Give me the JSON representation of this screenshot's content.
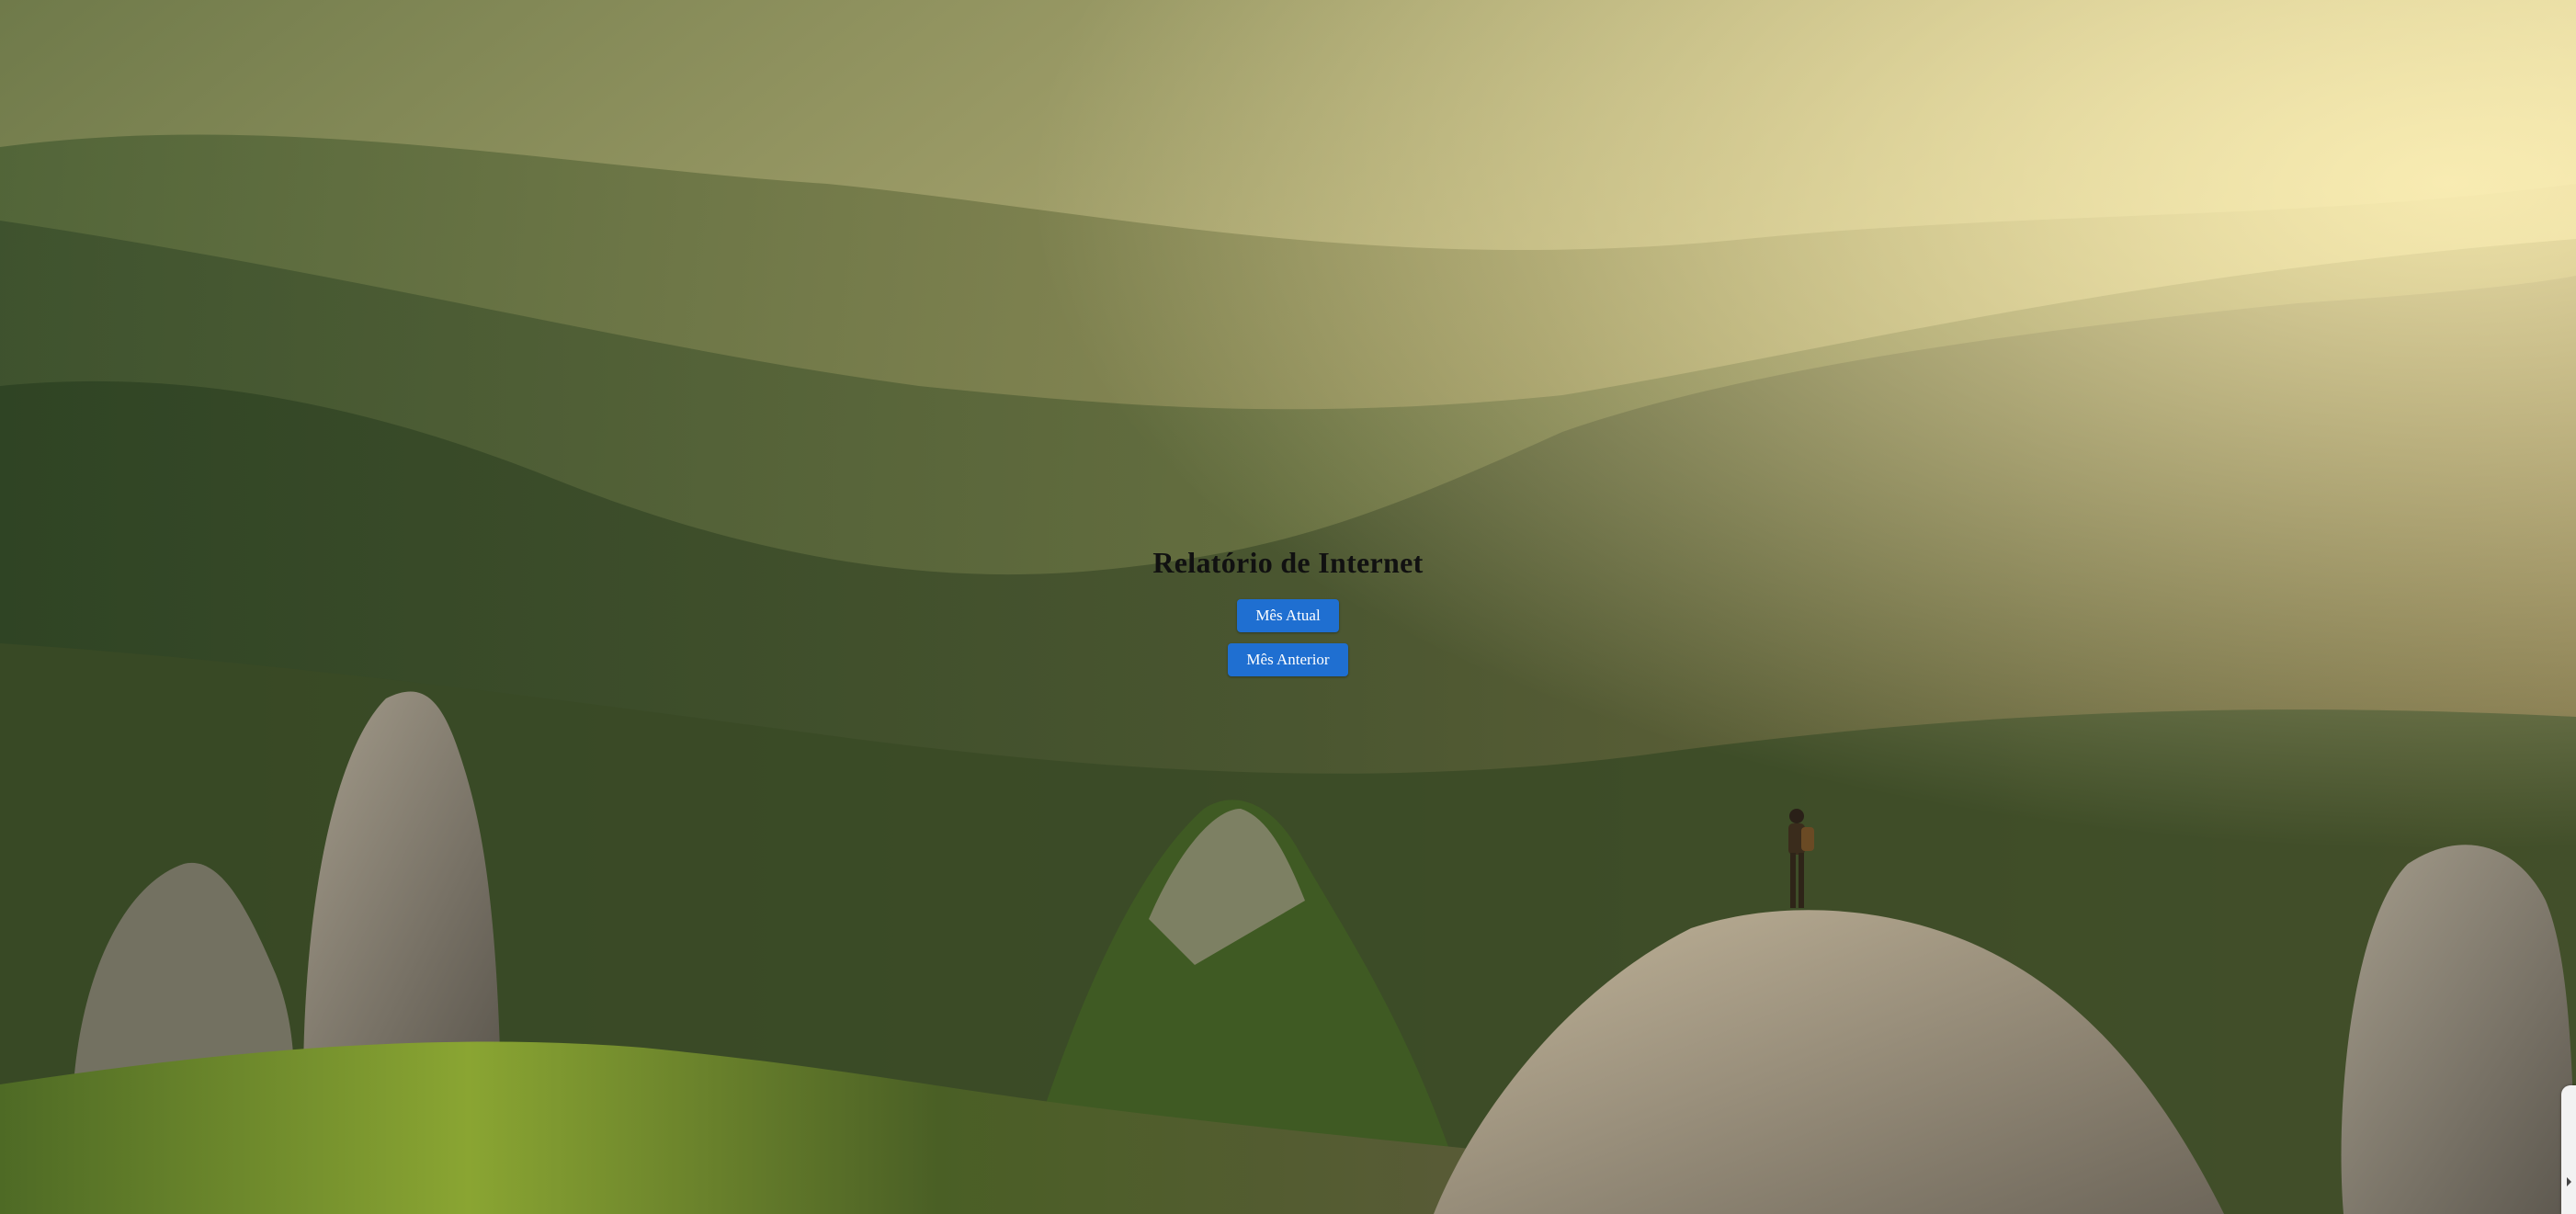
{
  "page": {
    "title": "Relatório de Internet"
  },
  "actions": {
    "current_month_label": "Mês Atual",
    "previous_month_label": "Mês Anterior"
  },
  "background": {
    "description_icon": "mountain-landscape-image",
    "colors": {
      "sky_glow": "#e8d9a0",
      "far_hills": "#b7b27a",
      "mid_forest": "#5f6a3a",
      "near_forest": "#3c4a26",
      "rock": "#8a847a",
      "grass": "#7e9a2e"
    }
  },
  "theme": {
    "button_color": "#1f6fd1",
    "button_text_color": "#ffffff",
    "title_color": "#111111"
  }
}
